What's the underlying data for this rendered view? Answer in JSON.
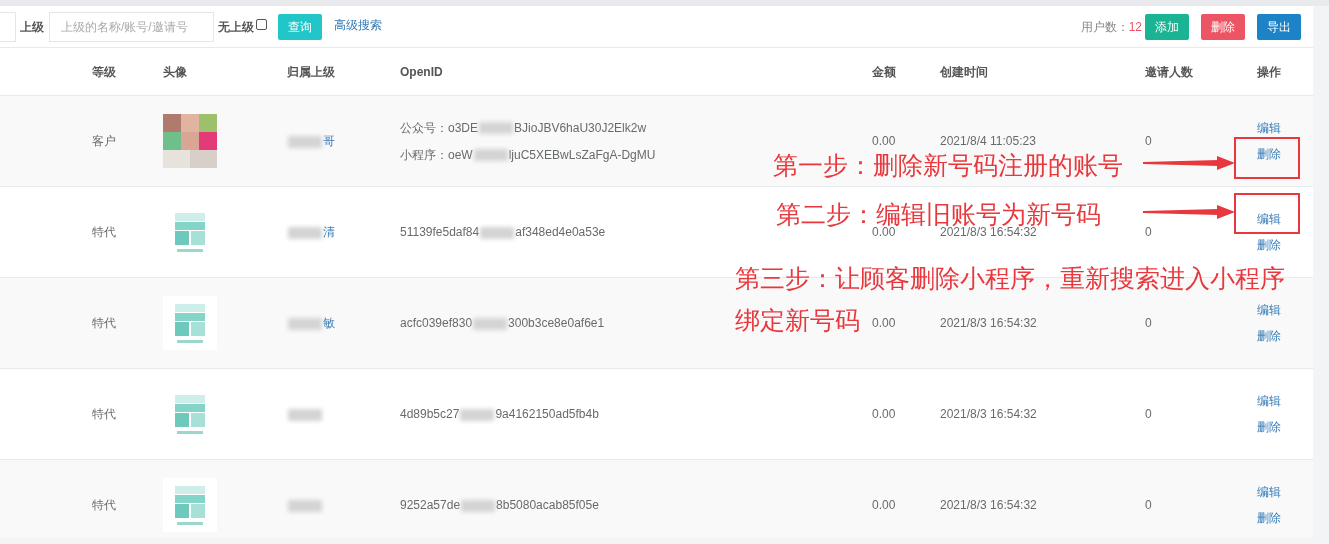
{
  "toolbar": {
    "parent_label": "上级",
    "parent_search": {
      "placeholder": "上级的名称/账号/邀请号"
    },
    "no_parent": {
      "label": "无上级",
      "checked": false
    },
    "query_button": "查询",
    "advanced_search": "高级搜索",
    "user_count_label": "用户数：",
    "user_count": "12",
    "buttons": [
      {
        "label": "添加",
        "kind": "add"
      },
      {
        "label": "删除",
        "kind": "delete"
      },
      {
        "label": "导出",
        "kind": "export"
      }
    ]
  },
  "table": {
    "columns": [
      "等级",
      "头像",
      "归属上级",
      "OpenID",
      "金额",
      "创建时间",
      "邀请人数",
      "操作"
    ],
    "rows": [
      {
        "level": "客户",
        "parent": "哥",
        "openids": [
          {
            "label": "公众号：",
            "head": "o3DE",
            "tail": "BJioJBV6haU30J2Elk2w"
          },
          {
            "label": "小程序：",
            "head": "oeW",
            "tail": "ljuC5XEBwLsZaFgA-DgMU"
          }
        ],
        "amount": "0.00",
        "created": "2021/8/4 11:05:23",
        "invites": "0",
        "actions": [
          "编辑",
          "删除"
        ]
      },
      {
        "level": "特代",
        "parent": "清",
        "openids": [
          {
            "head": "51139fe5daf84",
            "tail": "af348ed4e0a53e"
          }
        ],
        "amount": "0.00",
        "created": "2021/8/3 16:54:32",
        "invites": "0",
        "actions": [
          "编辑",
          "删除"
        ]
      },
      {
        "level": "特代",
        "parent": "敏",
        "openids": [
          {
            "head": "acfc039ef830",
            "tail": "300b3ce8e0af6e1"
          }
        ],
        "amount": "0.00",
        "created": "2021/8/3 16:54:32",
        "invites": "0",
        "actions": [
          "编辑",
          "删除"
        ]
      },
      {
        "level": "特代",
        "openids": [
          {
            "head": "4d89b5c27",
            "tail": "9a4162150ad5fb4b"
          }
        ],
        "amount": "0.00",
        "created": "2021/8/3 16:54:32",
        "invites": "0",
        "actions": [
          "编辑",
          "删除"
        ]
      },
      {
        "level": "特代",
        "openids": [
          {
            "head": "9252a57de",
            "tail": "8b5080acab85f05e"
          }
        ],
        "amount": "0.00",
        "created": "2021/8/3 16:54:32",
        "invites": "0",
        "actions": [
          "编辑",
          "删除"
        ]
      }
    ]
  },
  "annotations": [
    {
      "lines": [
        "第一步：删除新号码注册的账号"
      ],
      "arrow": true
    },
    {
      "lines": [
        "第二步：编辑旧账号为新号码"
      ],
      "arrow": true
    },
    {
      "lines": [
        "第三步：让顾客删除小程序，重新搜索进入小程序",
        "绑定新号码"
      ],
      "arrow": false
    }
  ]
}
